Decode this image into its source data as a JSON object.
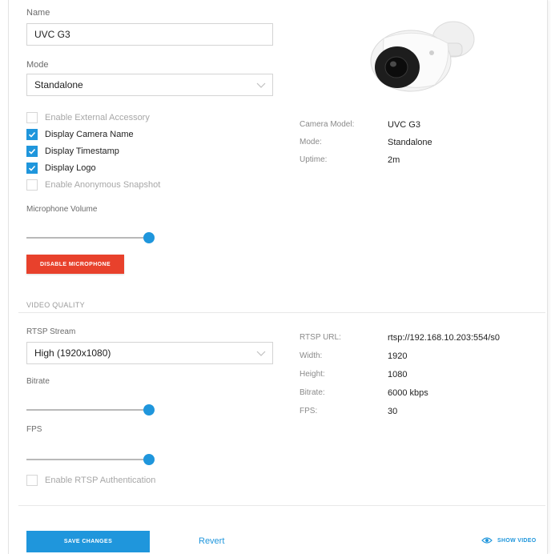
{
  "form": {
    "name_label": "Name",
    "name_value": "UVC G3",
    "mode_label": "Mode",
    "mode_value": "Standalone",
    "checkboxes": [
      {
        "label": "Enable External Accessory",
        "checked": false,
        "disabled": true
      },
      {
        "label": "Display Camera Name",
        "checked": true,
        "disabled": false
      },
      {
        "label": "Display Timestamp",
        "checked": true,
        "disabled": false
      },
      {
        "label": "Display Logo",
        "checked": true,
        "disabled": false
      },
      {
        "label": "Enable Anonymous Snapshot",
        "checked": false,
        "disabled": true
      }
    ],
    "microphone_label": "Microphone Volume",
    "microphone_level": 1.0,
    "disable_mic_label": "Disable Microphone"
  },
  "camera_info": {
    "rows": [
      {
        "key": "Camera Model:",
        "value": "UVC G3"
      },
      {
        "key": "Mode:",
        "value": "Standalone"
      },
      {
        "key": "Uptime:",
        "value": "2m"
      }
    ]
  },
  "video_quality": {
    "section_title": "Video Quality",
    "rtsp_label": "RTSP Stream",
    "rtsp_value": "High (1920x1080)",
    "bitrate_label": "Bitrate",
    "bitrate_level": 1.0,
    "fps_label": "FPS",
    "fps_level": 1.0,
    "rtsp_auth_label": "Enable RTSP Authentication",
    "rows": [
      {
        "key": "RTSP URL:",
        "value": "rtsp://192.168.10.203:554/s0"
      },
      {
        "key": "Width:",
        "value": "1920"
      },
      {
        "key": "Height:",
        "value": "1080"
      },
      {
        "key": "Bitrate:",
        "value": "6000 kbps"
      },
      {
        "key": "FPS:",
        "value": "30"
      }
    ]
  },
  "footer": {
    "save_label": "Save Changes",
    "revert_label": "Revert",
    "show_video_label": "Show Video"
  },
  "colors": {
    "accent": "#1f96dc",
    "danger": "#e8412c"
  }
}
